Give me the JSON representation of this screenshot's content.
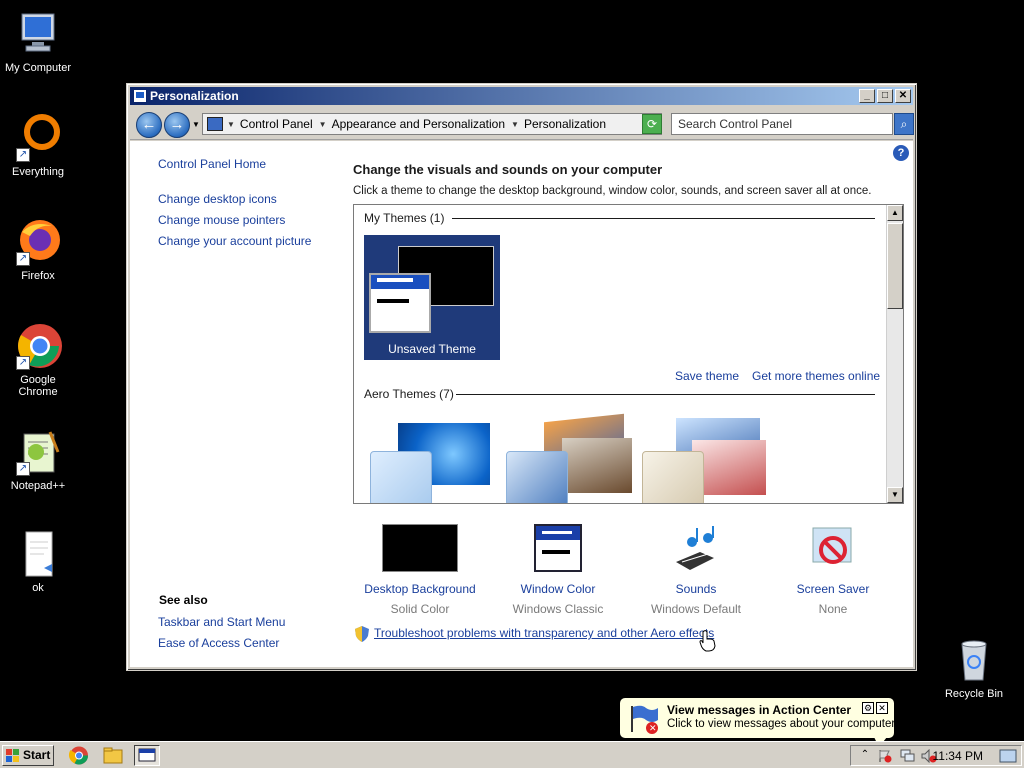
{
  "desktop": {
    "icons": [
      {
        "label": "My Computer"
      },
      {
        "label": "Everything"
      },
      {
        "label": "Firefox"
      },
      {
        "label": "Google Chrome"
      },
      {
        "label": "Notepad++"
      },
      {
        "label": "ok"
      },
      {
        "label": "Recycle Bin"
      }
    ]
  },
  "window": {
    "title": "Personalization",
    "breadcrumbs": [
      "Control Panel",
      "Appearance and Personalization",
      "Personalization"
    ],
    "search_placeholder": "Search Control Panel",
    "left_links": [
      "Control Panel Home",
      "Change desktop icons",
      "Change mouse pointers",
      "Change your account picture"
    ],
    "see_also_title": "See also",
    "see_also_links": [
      "Taskbar and Start Menu",
      "Ease of Access Center"
    ],
    "heading": "Change the visuals and sounds on your computer",
    "subtext": "Click a theme to change the desktop background, window color, sounds, and screen saver all at once.",
    "my_themes_header": "My Themes (1)",
    "unsaved_theme_label": "Unsaved Theme",
    "save_theme_link": "Save theme",
    "get_more_link": "Get more themes online",
    "aero_themes_header": "Aero Themes (7)",
    "bottom_items": [
      {
        "name": "Desktop Background",
        "sub": "Solid Color"
      },
      {
        "name": "Window Color",
        "sub": "Windows Classic"
      },
      {
        "name": "Sounds",
        "sub": "Windows Default"
      },
      {
        "name": "Screen Saver",
        "sub": "None"
      }
    ],
    "troubleshoot_link": "Troubleshoot problems with transparency and other Aero effects"
  },
  "balloon": {
    "title": "View messages in Action Center",
    "text": "Click to view messages about your computer."
  },
  "taskbar": {
    "start_label": "Start",
    "clock": "11:34 PM"
  },
  "colors": {
    "link": "#1a3f9c",
    "titlebar_start": "#0a246a",
    "titlebar_end": "#a6caf0",
    "taskbar": "#d4d0c8"
  }
}
